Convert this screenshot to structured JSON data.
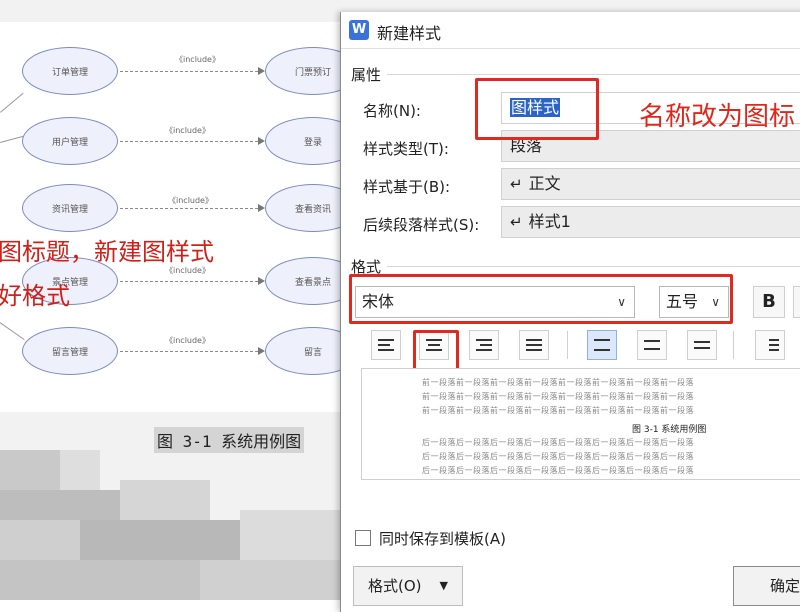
{
  "diagram": {
    "left_nodes": [
      "订单管理",
      "用户管理",
      "资讯管理",
      "景点管理",
      "留言管理"
    ],
    "right_nodes": [
      "门票预订",
      "登录",
      "查看资讯",
      "查看景点",
      "留言"
    ],
    "include_label": "《include》"
  },
  "annotations": {
    "left_line1": "图标题，新建图样式",
    "left_line2": "好格式",
    "right_note": "名称改为图标"
  },
  "figure_caption": "图 3-1 系统用例图",
  "dialog": {
    "title": "新建样式",
    "app_icon": "W",
    "attributes_section": "属性",
    "name_label": "名称(N):",
    "name_value": "图样式",
    "style_type_label": "样式类型(T):",
    "style_type_value": "段落",
    "based_on_label": "样式基于(B):",
    "based_on_value": "正文",
    "next_style_label": "后续段落样式(S):",
    "next_style_value": "样式1",
    "return_glyph": "↵",
    "format_section": "格式",
    "font_value": "宋体",
    "size_value": "五号",
    "bold_label": "B",
    "preview_before": "前一段落前一段落前一段落前一段落前一段落前一段落前一段落前一段落",
    "preview_caption": "图 3-1 系统用例图",
    "preview_after": "后一段落后一段落后一段落后一段落后一段落后一段落后一段落后一段落",
    "checkbox_label": "同时保存到模板(A)",
    "format_button": "格式(O)",
    "ok_button": "确定"
  },
  "colors": {
    "accent_red": "#e02a20",
    "selection_blue": "#2b63c6"
  }
}
